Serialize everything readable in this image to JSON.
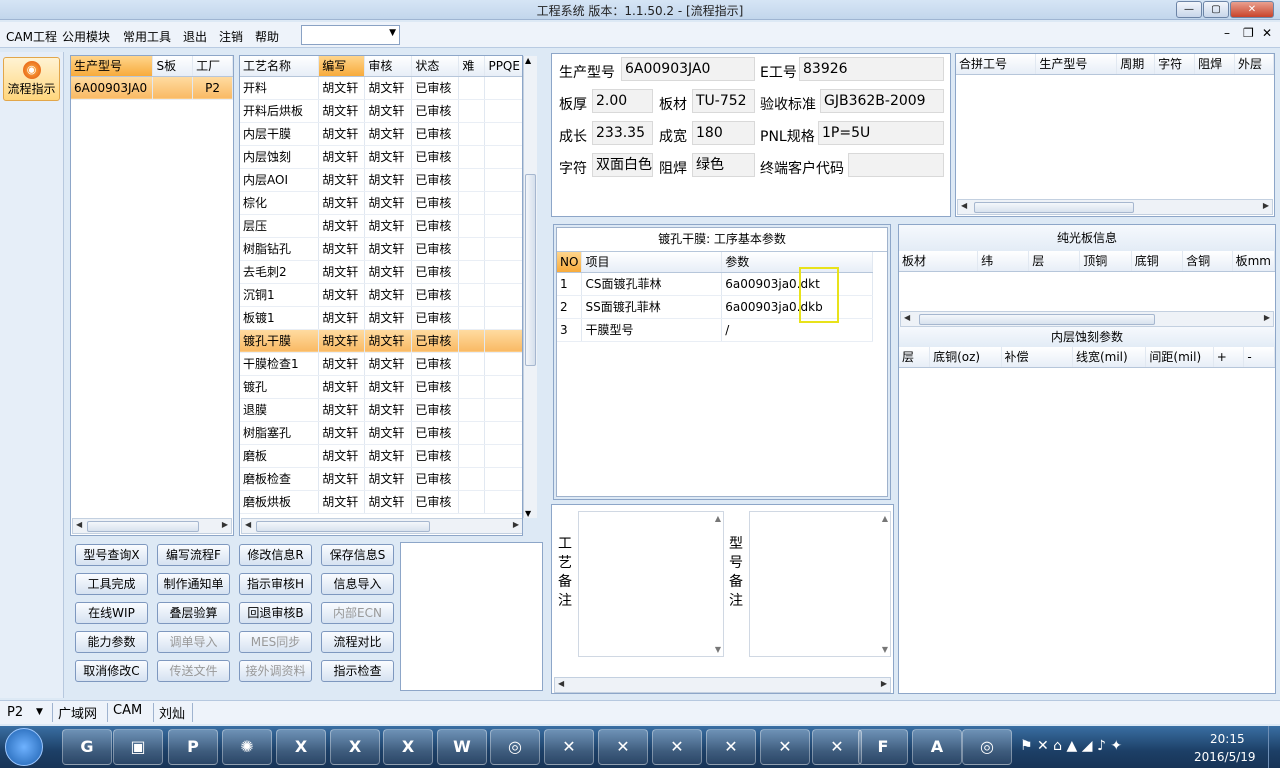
{
  "window": {
    "title": "工程系统  版本：1.1.50.2 - [流程指示]"
  },
  "menu": {
    "items": [
      "CAM工程",
      "公用模块",
      "常用工具",
      "退出",
      "注销",
      "帮助"
    ],
    "combo_value": ""
  },
  "sidebar": {
    "button_label": "流程指示"
  },
  "product_list": {
    "headers": [
      "生产型号",
      "S板",
      "工厂"
    ],
    "rows": [
      [
        "6A00903JA0",
        "",
        "P2"
      ]
    ]
  },
  "process_table": {
    "headers": [
      "工艺名称",
      "编写",
      "审核",
      "状态",
      "难",
      "PPQE"
    ],
    "rows": [
      [
        "开料",
        "胡文轩",
        "胡文轩",
        "已审核"
      ],
      [
        "开料后烘板",
        "胡文轩",
        "胡文轩",
        "已审核"
      ],
      [
        "内层干膜",
        "胡文轩",
        "胡文轩",
        "已审核"
      ],
      [
        "内层蚀刻",
        "胡文轩",
        "胡文轩",
        "已审核"
      ],
      [
        "内层AOI",
        "胡文轩",
        "胡文轩",
        "已审核"
      ],
      [
        "棕化",
        "胡文轩",
        "胡文轩",
        "已审核"
      ],
      [
        "层压",
        "胡文轩",
        "胡文轩",
        "已审核"
      ],
      [
        "树脂钻孔",
        "胡文轩",
        "胡文轩",
        "已审核"
      ],
      [
        "去毛刺2",
        "胡文轩",
        "胡文轩",
        "已审核"
      ],
      [
        "沉铜1",
        "胡文轩",
        "胡文轩",
        "已审核"
      ],
      [
        "板镀1",
        "胡文轩",
        "胡文轩",
        "已审核"
      ],
      [
        "镀孔干膜",
        "胡文轩",
        "胡文轩",
        "已审核"
      ],
      [
        "干膜检查1",
        "胡文轩",
        "胡文轩",
        "已审核"
      ],
      [
        "镀孔",
        "胡文轩",
        "胡文轩",
        "已审核"
      ],
      [
        "退膜",
        "胡文轩",
        "胡文轩",
        "已审核"
      ],
      [
        "树脂塞孔",
        "胡文轩",
        "胡文轩",
        "已审核"
      ],
      [
        "磨板",
        "胡文轩",
        "胡文轩",
        "已审核"
      ],
      [
        "磨板检查",
        "胡文轩",
        "胡文轩",
        "已审核"
      ],
      [
        "磨板烘板",
        "胡文轩",
        "胡文轩",
        "已审核"
      ]
    ]
  },
  "actions": [
    [
      "型号查询X",
      "编写流程F",
      "修改信息R",
      "保存信息S"
    ],
    [
      "工具完成",
      "制作通知单",
      "指示审核H",
      "信息导入"
    ],
    [
      "在线WIP",
      "叠层验算",
      "回退审核B",
      "内部ECN"
    ],
    [
      "能力参数",
      "调单导入",
      "MES同步",
      "流程对比"
    ],
    [
      "取消修改C",
      "传送文件",
      "接外调资料",
      "指示检查"
    ]
  ],
  "info": {
    "prod_no_label": "生产型号",
    "prod_no": "6A00903JA0",
    "e_no_label": "E工号",
    "e_no": "83926",
    "thickness_label": "板厚",
    "thickness": "2.00",
    "material_label": "板材",
    "material": "TU-752",
    "std_label": "验收标准",
    "std": "GJB362B-2009",
    "length_label": "成长",
    "length": "233.35",
    "width_label": "成宽",
    "width": "180",
    "pnl_label": "PNL规格",
    "pnl": "1P=5U",
    "char_label": "字符",
    "char": "双面白色",
    "solder_label": "阻焊",
    "solder": "绿色",
    "client_label": "终端客户代码",
    "client": ""
  },
  "merge_table": {
    "headers": [
      "合拼工号",
      "生产型号",
      "周期",
      "字符",
      "阻焊",
      "外层"
    ]
  },
  "param_panel": {
    "title": "镀孔干膜: 工序基本参数",
    "headers": [
      "NO",
      "项目",
      "参数"
    ],
    "rows": [
      [
        "1",
        "CS面镀孔菲林",
        "6a00903ja0.dkt"
      ],
      [
        "2",
        "SS面镀孔菲林",
        "6a00903ja0.dkb"
      ],
      [
        "3",
        "干膜型号",
        "/"
      ]
    ]
  },
  "board_info": {
    "title": "纯光板信息",
    "headers": [
      "板材",
      "纬",
      "层",
      "顶铜",
      "底铜",
      "含铜",
      "板mm"
    ]
  },
  "etch_params": {
    "title": "内层蚀刻参数",
    "headers": [
      "层",
      "底铜(oz)",
      "补偿",
      "线宽(mil)",
      "间距(mil)",
      "+",
      "-"
    ]
  },
  "notes": {
    "process_label": "工艺备注",
    "model_label": "型号备注"
  },
  "status": {
    "factory": "P2",
    "items": [
      "广域网",
      "CAM",
      "刘灿"
    ]
  },
  "taskbar": {
    "time": "20:15",
    "date": "2016/5/19"
  }
}
